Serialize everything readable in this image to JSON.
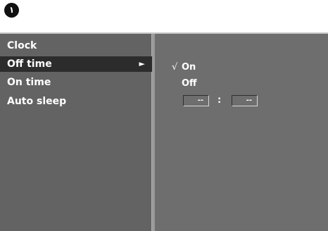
{
  "step": {
    "number": "١"
  },
  "menu": {
    "items": [
      {
        "label": "Clock",
        "selected": false
      },
      {
        "label": "Off time",
        "selected": true,
        "arrow": "►"
      },
      {
        "label": "On time",
        "selected": false
      },
      {
        "label": "Auto sleep",
        "selected": false
      }
    ]
  },
  "submenu": {
    "check_mark": "√",
    "options": [
      {
        "label": "On",
        "checked": true
      },
      {
        "label": "Off",
        "checked": false
      }
    ],
    "time": {
      "hour": "--",
      "separator": ":",
      "minute": "--"
    }
  },
  "colors": {
    "menu_background": "#636363",
    "submenu_background": "#6e6e6e",
    "highlight": "#2c2c2c",
    "text": "#ffffff"
  }
}
